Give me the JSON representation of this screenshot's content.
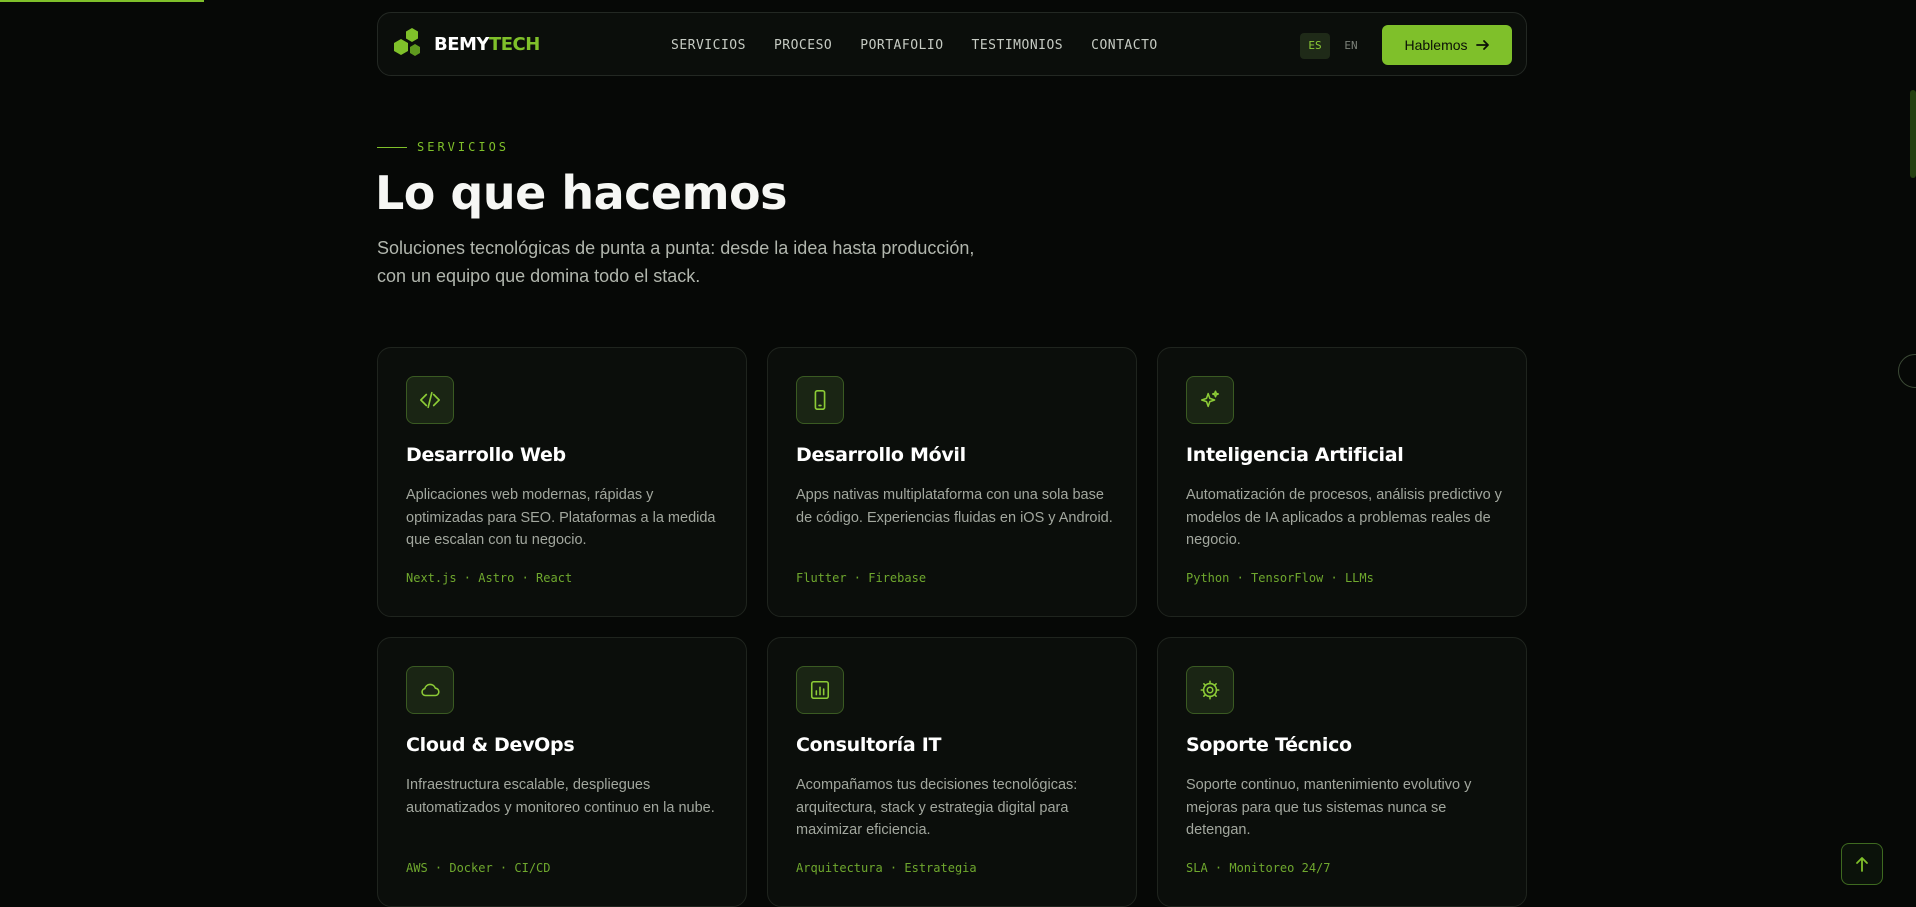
{
  "brand": {
    "name_part1": "BEMY",
    "name_part2": "TECH",
    "accent": "#7fc02a",
    "background": "#060806"
  },
  "nav": {
    "links": [
      "SERVICIOS",
      "PROCESO",
      "PORTAFOLIO",
      "TESTIMONIOS",
      "CONTACTO"
    ],
    "lang_active": "ES",
    "lang_other": "EN",
    "cta_label": "Hablemos",
    "cta_icon": "arrow-right-icon"
  },
  "section": {
    "kicker": "SERVICIOS",
    "title": "Lo que hacemos",
    "lead_line1": "Soluciones tecnológicas de punta a punta: desde la idea hasta producción,",
    "lead_line2": "con un equipo que domina todo el stack."
  },
  "services": [
    {
      "icon": "code-icon",
      "title": "Desarrollo Web",
      "description": "Aplicaciones web modernas, rápidas y optimizadas para SEO. Plataformas a la medida que escalan con tu negocio.",
      "tags": "Next.js · Astro · React"
    },
    {
      "icon": "smartphone-icon",
      "title": "Desarrollo Móvil",
      "description": "Apps nativas multiplataforma con una sola base de código. Experiencias fluidas en iOS y Android.",
      "tags": "Flutter · Firebase"
    },
    {
      "icon": "sparkles-icon",
      "title": "Inteligencia Artificial",
      "description": "Automatización de procesos, análisis predictivo y modelos de IA aplicados a problemas reales de negocio.",
      "tags": "Python · TensorFlow · LLMs"
    },
    {
      "icon": "cloud-icon",
      "title": "Cloud & DevOps",
      "description": "Infraestructura escalable, despliegues automatizados y monitoreo continuo en la nube.",
      "tags": "AWS · Docker · CI/CD"
    },
    {
      "icon": "bar-chart-icon",
      "title": "Consultoría IT",
      "description": "Acompañamos tus decisiones tecnológicas: arquitectura, stack y estrategia digital para maximizar eficiencia.",
      "tags": "Arquitectura · Estrategia"
    },
    {
      "icon": "gear-icon",
      "title": "Soporte Técnico",
      "description": "Soporte continuo, mantenimiento evolutivo y mejoras para que tus sistemas nunca se detengan.",
      "tags": "SLA · Monitoreo 24/7"
    }
  ],
  "back_to_top_icon": "arrow-up-icon"
}
